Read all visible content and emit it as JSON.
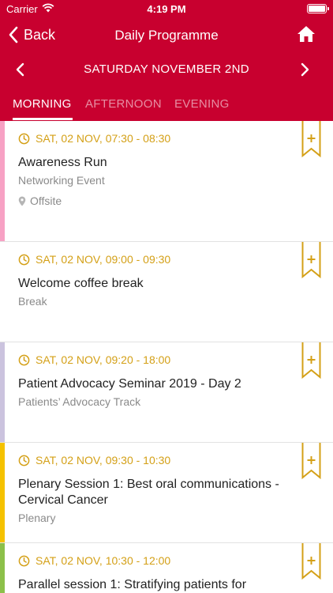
{
  "status": {
    "carrier": "Carrier",
    "time": "4:19 PM"
  },
  "nav": {
    "back_label": "Back",
    "title": "Daily Programme"
  },
  "date": {
    "label": "SATURDAY NOVEMBER 2ND"
  },
  "tabs": [
    {
      "label": "MORNING",
      "active": true
    },
    {
      "label": "AFTERNOON",
      "active": false
    },
    {
      "label": "EVENING",
      "active": false
    }
  ],
  "colors": {
    "brand": "#c8002f",
    "accent": "#d4a017"
  },
  "events": [
    {
      "time": "SAT, 02 NOV, 07:30 - 08:30",
      "title": "Awareness Run",
      "subtitle": "Networking Event",
      "location": "Offsite",
      "stripe": "#f7a1c4"
    },
    {
      "time": "SAT, 02 NOV, 09:00 - 09:30",
      "title": "Welcome coffee break",
      "subtitle": "Break",
      "stripe": ""
    },
    {
      "time": "SAT, 02 NOV, 09:20 - 18:00",
      "title": "Patient Advocacy Seminar 2019 - Day 2",
      "subtitle": "Patients’ Advocacy Track",
      "stripe": "#cbc3de"
    },
    {
      "time": "SAT, 02 NOV, 09:30 - 10:30",
      "title": "Plenary Session 1: Best oral communications - Cervical Cancer",
      "subtitle": "Plenary",
      "stripe": "#f5c200"
    },
    {
      "time": "SAT, 02 NOV, 10:30 - 12:00",
      "title": "Parallel session 1: Stratifying patients for",
      "subtitle": "",
      "stripe": "#8cc04a"
    }
  ]
}
